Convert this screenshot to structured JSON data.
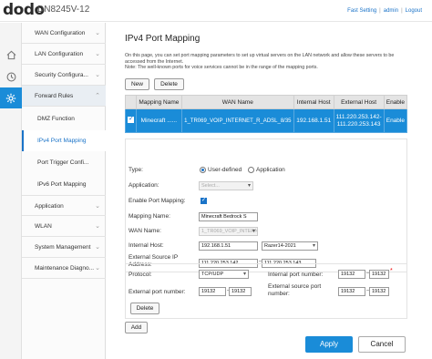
{
  "header": {
    "brand": "dodo",
    "model": "DN8245V-12",
    "links": [
      "Fast Setting",
      "admin",
      "Logout"
    ]
  },
  "iconbar": [
    "home-icon",
    "globe-icon",
    "gear-icon"
  ],
  "menu": {
    "items": [
      {
        "label": "WAN Configuration"
      },
      {
        "label": "LAN Configuration"
      },
      {
        "label": "Security Configura..."
      },
      {
        "label": "Forward Rules"
      },
      {
        "label": "Application"
      },
      {
        "label": "WLAN"
      },
      {
        "label": "System Management"
      },
      {
        "label": "Maintenance Diagno..."
      }
    ],
    "subitems": [
      "DMZ Function",
      "IPv4 Port Mapping",
      "Port Trigger Confi...",
      "IPv6 Port Mapping"
    ]
  },
  "page": {
    "title": "IPv4 Port Mapping",
    "description": "On this page, you can set port mapping parameters to set up virtual servers on the LAN network and allow these servers to be accessed from the Internet.\nNote: The well-known ports for voice services cannot be in the range of the mapping ports.",
    "new_button": "New",
    "delete_button": "Delete"
  },
  "table": {
    "headers": [
      "",
      "Mapping Name",
      "WAN Name",
      "Internal Host",
      "External Host",
      "Enable"
    ],
    "rows": [
      {
        "name": "Minecraft ......",
        "wan": "1_TR069_VOIP_INTERNET_R_ADSL_8/35",
        "internal": "192.168.1.51",
        "external_1": "111.220.253.142-",
        "external_2": "111.220.253.143",
        "enable": "Enable"
      }
    ]
  },
  "form": {
    "type_label": "Type:",
    "type_option_1": "User-defined",
    "type_option_2": "Application",
    "application_label": "Application:",
    "application_value": "Select...",
    "enable_label": "Enable Port Mapping:",
    "mapping_name_label": "Mapping Name:",
    "mapping_name_value": "Minecraft Bedrock S",
    "wan_name_label": "WAN Name:",
    "wan_name_value": "1_TR069_VOIP_INTERNET_R_ADSL_8/35",
    "internal_host_label": "Internal Host:",
    "internal_host_value": "192.168.1.51",
    "internal_host_device": "Razer14-2021",
    "external_source_label": "External Source IP Address:",
    "external_source_start": "111.220.253.142",
    "external_source_end": "111.220.253.143"
  },
  "ports": {
    "protocol_label": "Protocol:",
    "protocol_value": "TCP/UDP",
    "internal_port_label": "Internal port number:",
    "internal_port_start": "19132",
    "internal_port_end": "19132",
    "external_port_label": "External port number:",
    "external_port_start": "19132",
    "external_port_end": "19132",
    "external_source_port_label": "External source port number:",
    "external_source_port_start": "19132",
    "external_source_port_end": "19132",
    "delete_label": "Delete",
    "separator": "—",
    "required_marker": "*"
  },
  "actions": {
    "add_label": "Add",
    "apply_label": "Apply",
    "cancel_label": "Cancel"
  }
}
